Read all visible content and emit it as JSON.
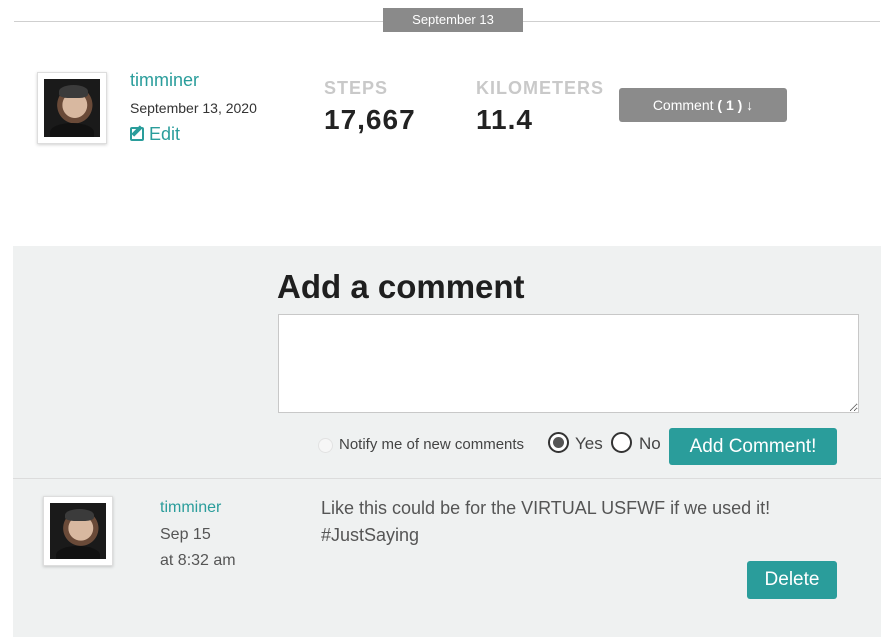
{
  "date_divider": {
    "label": "September 13"
  },
  "entry": {
    "username": "timminer",
    "date": "September 13, 2020",
    "edit_label": "Edit",
    "steps_label": "STEPS",
    "steps_value": "17,667",
    "km_label": "KILOMETERS",
    "km_value": "11.4",
    "comment_toggle_prefix": "Comment ",
    "comment_count": "( 1 )",
    "comment_toggle_arrow": " ↓"
  },
  "comment_form": {
    "title": "Add a comment",
    "textarea_value": "",
    "notify_label": "Notify me of new comments",
    "yes_label": "Yes",
    "no_label": "No",
    "selected": "Yes",
    "submit_label": "Add Comment!"
  },
  "comments": [
    {
      "username": "timminer",
      "date": "Sep 15",
      "time": "at 8:32 am",
      "text_line1": "Like this could be for the VIRTUAL USFWF if we used it!",
      "text_line2": "#JustSaying",
      "delete_label": "Delete"
    }
  ],
  "colors": {
    "accent": "#2a9d9b",
    "muted_button": "#8b8b8b",
    "panel_bg": "#eff1f1"
  },
  "icons": {
    "edit": "edit-icon",
    "notify": "check-circle-icon"
  }
}
